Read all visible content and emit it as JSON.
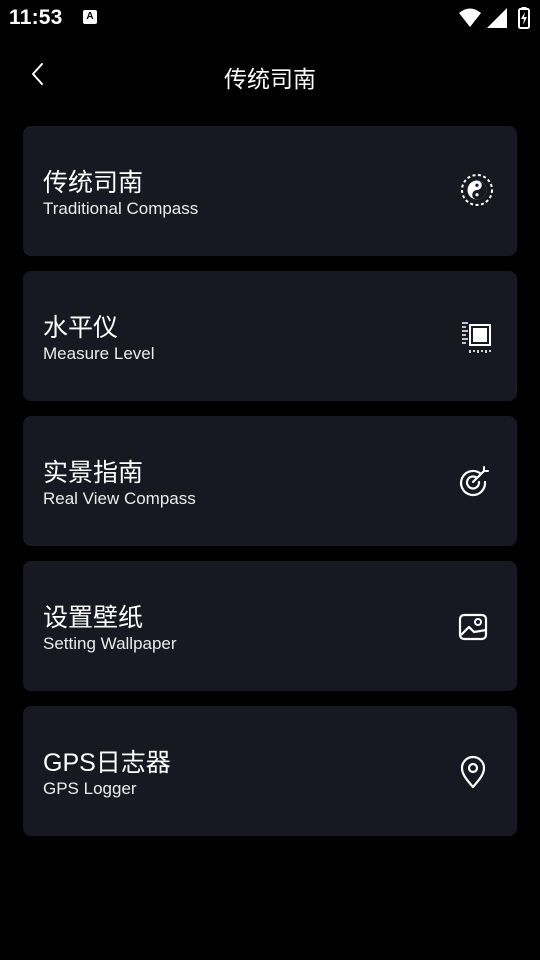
{
  "status_bar": {
    "time": "11:53",
    "app_icon_letter": "A",
    "icons": [
      "wifi-icon",
      "signal-icon",
      "battery-icon"
    ]
  },
  "header": {
    "title": "传统司南",
    "back_icon": "chevron-left-icon"
  },
  "menu": {
    "items": [
      {
        "title": "传统司南",
        "subtitle": "Traditional Compass",
        "icon": "yin-yang-compass-icon"
      },
      {
        "title": "水平仪",
        "subtitle": "Measure Level",
        "icon": "level-meter-icon"
      },
      {
        "title": "实景指南",
        "subtitle": "Real View Compass",
        "icon": "target-icon"
      },
      {
        "title": "设置壁纸",
        "subtitle": "Setting Wallpaper",
        "icon": "image-icon"
      },
      {
        "title": "GPS日志器",
        "subtitle": "GPS Logger",
        "icon": "location-pin-icon"
      }
    ]
  },
  "colors": {
    "background": "#000000",
    "card": "#181822",
    "text": "#ffffff"
  }
}
